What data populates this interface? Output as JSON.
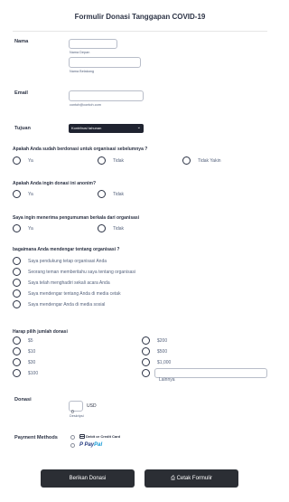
{
  "form": {
    "title": "Formulir Donasi Tanggapan COVID-19",
    "name": {
      "label": "Nama",
      "first_sublabel": "Nama Depan",
      "last_sublabel": "Nama Belakang"
    },
    "email": {
      "label": "Email",
      "sublabel": "contoh@contoh.com"
    },
    "tujuan": {
      "label": "Tujuan",
      "selected": "Kontribusi tahunan"
    },
    "q_donated_before": {
      "question": "Apakah Anda sudah berdonasi untuk organisasi sebelumnya ?",
      "options": [
        "Ya",
        "Tidak",
        "Tidak Yakin"
      ]
    },
    "q_anonymous": {
      "question": "Apakah Anda ingin donasi ini anonim?",
      "options": [
        "Ya",
        "Tidak"
      ]
    },
    "q_announcements": {
      "question": "Saya ingin menerima pengumuman berkala dari organisasi",
      "options": [
        "Ya",
        "Tidak"
      ]
    },
    "q_heard": {
      "question": "bagaimana Anda mendengar tentang organisasi ?",
      "options": [
        "Saya pendukung tetap organisasi Anda",
        "Seorang teman memberitahu saya tentang organisasi",
        "Saya telah menghadiri sekali acara Anda",
        "Saya mendengar tentang Anda di media cetak",
        "Saya mendengar Anda di media sosial"
      ]
    },
    "amount": {
      "question": "Harap pilih jumlah donasi",
      "left_options": [
        "$5",
        "$10",
        "$30",
        "$100"
      ],
      "right_options": [
        "$200",
        "$500",
        "$1,000"
      ],
      "other_placeholder": "Lainnya"
    },
    "donasi": {
      "label": "Donasi",
      "value": "0",
      "currency": "USD",
      "sublabel": "Deskripsi"
    },
    "payment": {
      "label": "Payment Methods",
      "card_label": "Debit or Credit Card",
      "paypal_p": "P",
      "paypal_pay": "Pay",
      "paypal_pal": "Pal"
    },
    "buttons": {
      "submit": "Berikan Donasi",
      "print": "Cetak Formulir",
      "print_icon": "⎙"
    }
  }
}
